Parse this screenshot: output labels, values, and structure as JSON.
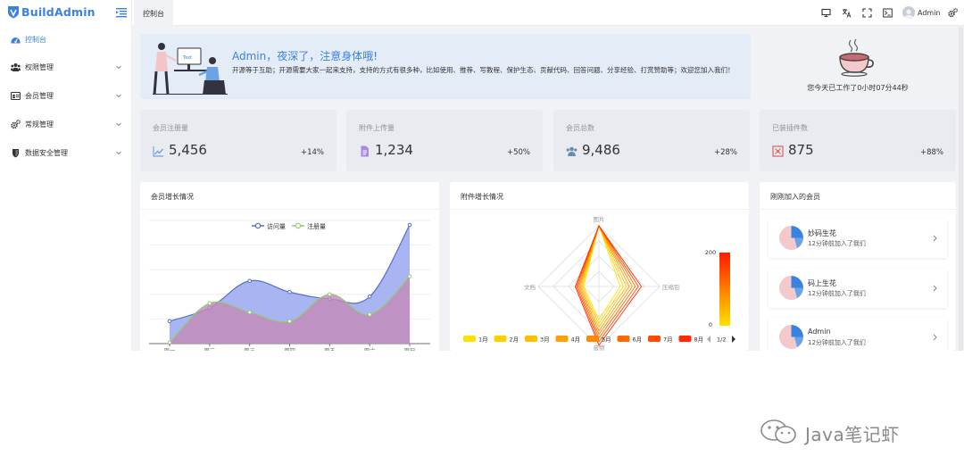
{
  "app": {
    "logo_text": "BuildAdmin"
  },
  "sidebar": {
    "items": [
      {
        "label": "控制台",
        "icon": "dashboard-icon",
        "active": true
      },
      {
        "label": "权限管理",
        "icon": "users-icon"
      },
      {
        "label": "会员管理",
        "icon": "id-card-icon"
      },
      {
        "label": "常规管理",
        "icon": "gears-icon"
      },
      {
        "label": "数据安全管理",
        "icon": "shield-icon"
      }
    ]
  },
  "header": {
    "active_tab": "控制台",
    "icons": [
      "monitor-icon",
      "translate-icon",
      "fullscreen-icon",
      "terminal-icon",
      "settings-icon"
    ],
    "username": "Admin"
  },
  "welcome": {
    "title": "Admin，夜深了，注意身体哦!",
    "description": "开源等于互助；开源需要大家一起来支持，支持的方式有很多种，比如使用、推荐、写教程、保护生态、贡献代码、回答问题、分享经验、打赏赞助等；欢迎您加入我们！",
    "illustration_screen_text": "Text"
  },
  "worktime": {
    "text": "您今天已工作了0小时07分44秒"
  },
  "stats": [
    {
      "title": "会员注册量",
      "value": "5,456",
      "change": "+14%",
      "icon": "line-chart-icon",
      "color": "#7a9fe0"
    },
    {
      "title": "附件上传量",
      "value": "1,234",
      "change": "+50%",
      "icon": "file-icon",
      "color": "#a888e0"
    },
    {
      "title": "会员总数",
      "value": "9,486",
      "change": "+28%",
      "icon": "users-icon",
      "color": "#6a8aa8"
    },
    {
      "title": "已装插件数",
      "value": "875",
      "change": "+88%",
      "icon": "plugin-icon",
      "color": "#e06a6a"
    }
  ],
  "member_growth": {
    "title": "会员增长情况",
    "chart_data": {
      "type": "line",
      "area": true,
      "smooth": true,
      "categories": [
        "周一",
        "周二",
        "周三",
        "周四",
        "周五",
        "周六",
        "周日"
      ],
      "series": [
        {
          "name": "访问量",
          "values": [
            100,
            160,
            280,
            230,
            200,
            210,
            530
          ],
          "color": "#5470c6",
          "fill": "#9aa8f0"
        },
        {
          "name": "注册量",
          "values": [
            5,
            180,
            140,
            100,
            220,
            130,
            300
          ],
          "color": "#91cc75",
          "fill": "#c48ab8"
        }
      ],
      "ylim": [
        0,
        550
      ],
      "grid": true,
      "legend_position": "top-center"
    }
  },
  "attachment_growth": {
    "title": "附件增长情况",
    "chart_data": {
      "type": "radar",
      "indicators": [
        "图片",
        "压缩包",
        "音频",
        "文档"
      ],
      "series": [
        {
          "name": "1月",
          "color": "#ffe100"
        },
        {
          "name": "2月",
          "color": "#ffd000"
        },
        {
          "name": "3月",
          "color": "#ffbf00"
        },
        {
          "name": "4月",
          "color": "#ff9f00"
        },
        {
          "name": "5月",
          "color": "#ff8800"
        },
        {
          "name": "6月",
          "color": "#ff6a00"
        },
        {
          "name": "7月",
          "color": "#ff4a00"
        },
        {
          "name": "8月",
          "color": "#ff2a00"
        }
      ],
      "visual_map": {
        "min": 0,
        "max": 200,
        "min_label": "0",
        "max_label": "200"
      },
      "legend_page": "1/2"
    }
  },
  "new_members": {
    "title": "刚刚加入的会员",
    "items": [
      {
        "name": "妙码生花",
        "desc": "12分钟前加入了我们"
      },
      {
        "name": "码上生花",
        "desc": "12分钟前加入了我们"
      },
      {
        "name": "Admin",
        "desc": "12分钟前加入了我们"
      }
    ]
  },
  "watermark": {
    "text": "Java笔记虾"
  }
}
